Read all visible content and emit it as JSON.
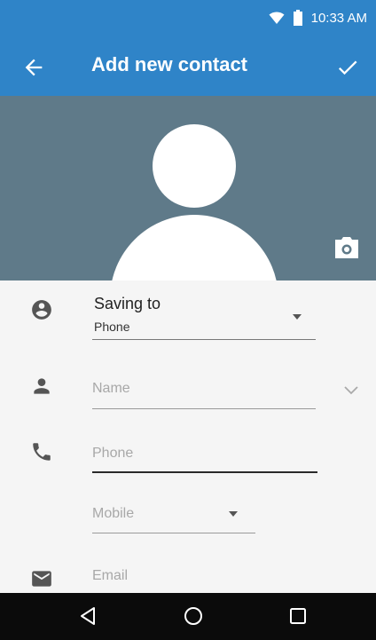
{
  "status_bar": {
    "time": "10:33 AM",
    "icons": [
      "wifi-icon",
      "battery-icon"
    ]
  },
  "app_bar": {
    "title": "Add new contact",
    "back_icon": "arrow-back-icon",
    "confirm_icon": "check-icon"
  },
  "photo": {
    "placeholder_icon": "person-silhouette",
    "camera_icon": "camera-icon"
  },
  "form": {
    "saving_to": {
      "label": "Saving to",
      "value": "Phone"
    },
    "name": {
      "placeholder": "Name"
    },
    "phone": {
      "placeholder": "Phone"
    },
    "phone_type": {
      "value": "Mobile"
    },
    "email": {
      "placeholder": "Email"
    }
  },
  "nav_bar": {
    "buttons": [
      "back-triangle",
      "home-circle",
      "recents-square"
    ]
  },
  "colors": {
    "accent": "#2f84c8",
    "photo_bg": "#5f7a89",
    "nav_bg": "#0b0b0b",
    "form_bg": "#f5f5f5"
  }
}
